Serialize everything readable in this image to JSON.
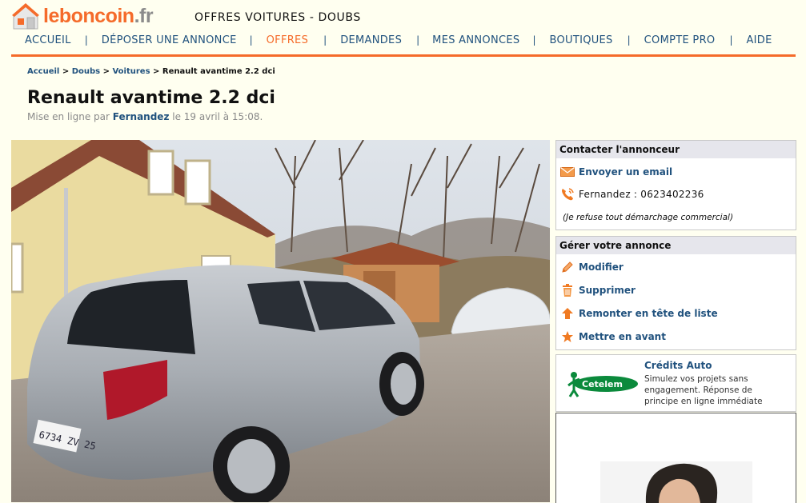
{
  "header": {
    "logo": {
      "name": "leboncoin",
      "tld": ".fr"
    },
    "page_heading": "OFFRES VOITURES - DOUBS"
  },
  "nav": {
    "items": [
      {
        "label": "ACCUEIL"
      },
      {
        "label": "DÉPOSER UNE ANNONCE"
      },
      {
        "label": "OFFRES",
        "active": true
      },
      {
        "label": "DEMANDES"
      },
      {
        "label": "MES ANNONCES"
      },
      {
        "label": "BOUTIQUES"
      },
      {
        "label": "COMPTE PRO"
      },
      {
        "label": "AIDE"
      }
    ],
    "separator": "|",
    "accent_color": "#f56b2a",
    "link_color": "#21527e"
  },
  "breadcrumb": {
    "items": [
      "Accueil",
      "Doubs",
      "Voitures"
    ],
    "separator": ">",
    "current": "Renault avantime 2.2 dci"
  },
  "listing": {
    "title": "Renault avantime 2.2 dci",
    "posted_prefix": "Mise en ligne par",
    "author": "Fernandez",
    "posted_suffix": "le 19 avril à 15:08.",
    "photo": {
      "license_plate": "6734 ZV 25"
    }
  },
  "contact_box": {
    "title": "Contacter l'annonceur",
    "email_label": "Envoyer un email",
    "phone_name": "Fernandez",
    "phone_sep": ":",
    "phone_number": "0623402236",
    "note": "(Je refuse tout démarchage commercial)"
  },
  "manage_box": {
    "title": "Gérer votre annonce",
    "actions": [
      {
        "label": "Modifier",
        "icon": "pencil-icon"
      },
      {
        "label": "Supprimer",
        "icon": "trash-icon"
      },
      {
        "label": "Remonter en tête de liste",
        "icon": "arrow-up-icon"
      },
      {
        "label": "Mettre en avant",
        "icon": "star-icon"
      }
    ]
  },
  "credit_box": {
    "logo_text": "Cetelem",
    "title": "Crédits Auto",
    "description": "Simulez vos projets sans engagement. Réponse de principe en ligne immédiate"
  }
}
